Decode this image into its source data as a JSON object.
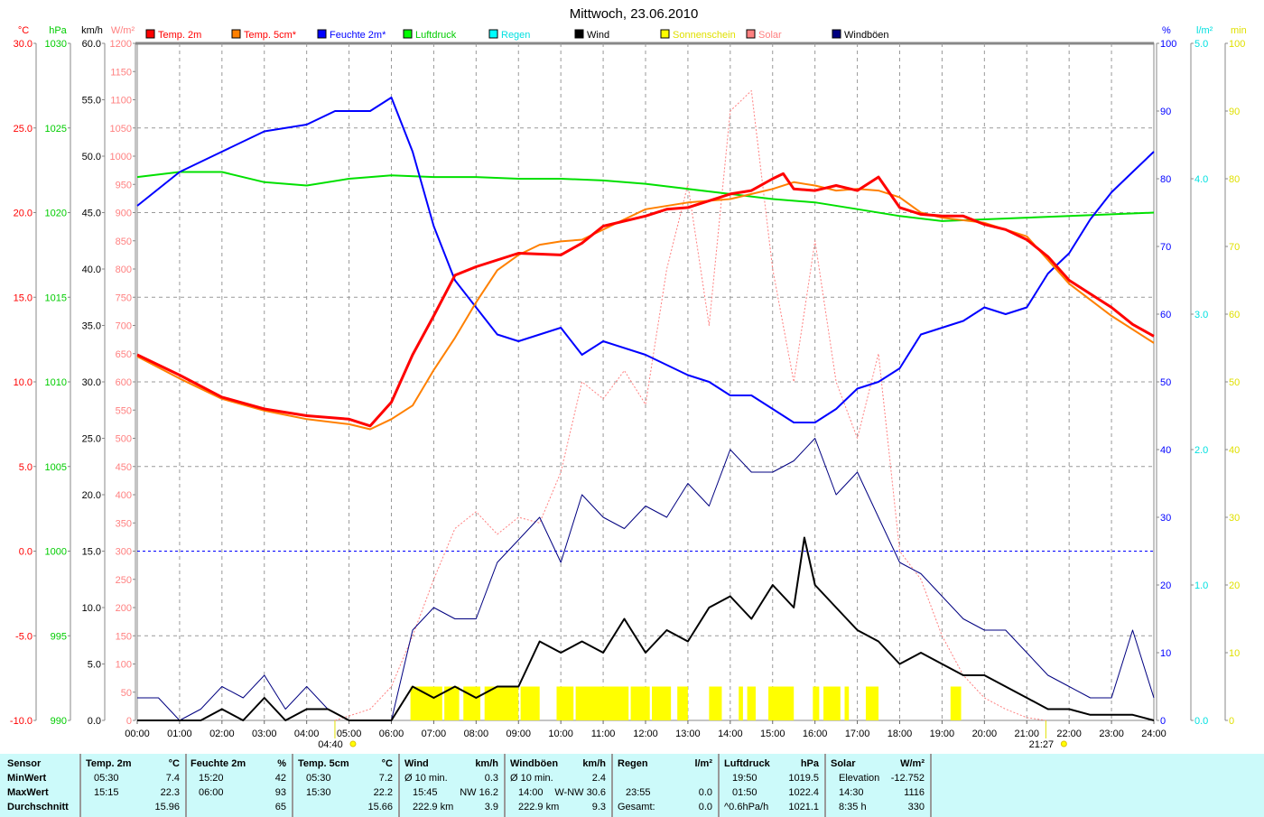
{
  "chart_data": {
    "type": "line",
    "title": "Mittwoch, 23.06.2010",
    "x_range_hours": [
      0,
      24
    ],
    "x_ticks": [
      "00:00",
      "01:00",
      "02:00",
      "03:00",
      "04:00",
      "05:00",
      "06:00",
      "07:00",
      "08:00",
      "09:00",
      "10:00",
      "11:00",
      "12:00",
      "13:00",
      "14:00",
      "15:00",
      "16:00",
      "17:00",
      "18:00",
      "19:00",
      "20:00",
      "21:00",
      "22:00",
      "23:00",
      "24:00"
    ],
    "sunrise": {
      "time": "04:40",
      "hour": 4.667
    },
    "sunset": {
      "time": "21:27",
      "hour": 21.45
    },
    "axes": {
      "temp": {
        "unit": "°C",
        "range": [
          -10,
          30
        ],
        "step": 5,
        "color": "#ff0000",
        "decimals": 1
      },
      "pressure": {
        "unit": "hPa",
        "range": [
          990,
          1030
        ],
        "step": 5,
        "color": "#00cc00",
        "decimals": 0
      },
      "wind": {
        "unit": "km/h",
        "range": [
          0,
          60
        ],
        "step": 5,
        "color": "#000000",
        "decimals": 1
      },
      "solar": {
        "unit": "W/m²",
        "range": [
          0,
          1200
        ],
        "step": 50,
        "color": "#ff8080",
        "decimals": 0
      },
      "humidity": {
        "unit": "%",
        "range": [
          0,
          100
        ],
        "step": 10,
        "color": "#0000ff",
        "decimals": 0
      },
      "rain": {
        "unit": "l/m²",
        "range": [
          0,
          5
        ],
        "step": 1,
        "color": "#00e0e0",
        "decimals": 1
      },
      "sunshine": {
        "unit": "min",
        "range": [
          0,
          100
        ],
        "step": 10,
        "color": "#e0e000",
        "decimals": 0
      }
    },
    "legend": [
      {
        "name": "Temp. 2m",
        "color": "#ff0000",
        "text_color": "#ff0000"
      },
      {
        "name": "Temp. 5cm*",
        "color": "#ff8000",
        "text_color": "#ff0000"
      },
      {
        "name": "Feuchte 2m*",
        "color": "#0000ff",
        "text_color": "#0000ff"
      },
      {
        "name": "Luftdruck",
        "color": "#00ff00",
        "text_color": "#00cc00"
      },
      {
        "name": "Regen",
        "color": "#00ffff",
        "text_color": "#00e0e0"
      },
      {
        "name": "Wind",
        "color": "#000000",
        "text_color": "#000000"
      },
      {
        "name": "Sonnenschein",
        "color": "#ffff00",
        "text_color": "#e0e000"
      },
      {
        "name": "Solar",
        "color": "#ff8080",
        "text_color": "#ff8080"
      },
      {
        "name": "Windböen",
        "color": "#000080",
        "text_color": "#000000"
      }
    ],
    "series": [
      {
        "name": "Solar",
        "axis": "solar",
        "color": "#ff8080",
        "style": "dotted",
        "x": [
          4.67,
          5.5,
          6,
          6.5,
          7,
          7.5,
          8,
          8.5,
          9,
          9.5,
          10,
          10.5,
          11,
          11.5,
          12,
          12.5,
          13,
          13.5,
          14,
          14.5,
          15,
          15.5,
          16,
          16.5,
          17,
          17.5,
          18,
          18.5,
          19,
          19.5,
          20,
          20.5,
          21,
          21.45
        ],
        "y": [
          0,
          20,
          60,
          150,
          250,
          340,
          370,
          330,
          360,
          350,
          440,
          600,
          570,
          620,
          560,
          800,
          950,
          700,
          1080,
          1116,
          800,
          600,
          850,
          600,
          500,
          650,
          300,
          250,
          150,
          80,
          40,
          20,
          5,
          0
        ]
      },
      {
        "name": "Windböen",
        "axis": "wind",
        "color": "#000080",
        "width": 1,
        "x": [
          0,
          0.5,
          1,
          1.5,
          2,
          2.5,
          3,
          3.5,
          4,
          4.5,
          5,
          5.5,
          6,
          6.5,
          7,
          7.5,
          8,
          8.5,
          9,
          9.5,
          10,
          10.5,
          11,
          11.5,
          12,
          12.5,
          13,
          13.5,
          14,
          14.5,
          15,
          15.5,
          16,
          16.5,
          17,
          17.5,
          18,
          18.5,
          19,
          19.5,
          20,
          20.5,
          21,
          21.5,
          22,
          22.5,
          23,
          23.5,
          24
        ],
        "y": [
          2,
          2,
          0,
          1,
          3,
          2,
          4,
          1,
          3,
          1,
          0,
          0,
          0,
          8,
          10,
          9,
          9,
          14,
          16,
          18,
          14,
          20,
          18,
          17,
          19,
          18,
          21,
          19,
          24,
          22,
          22,
          23,
          25,
          20,
          22,
          18,
          14,
          13,
          11,
          9,
          8,
          8,
          6,
          4,
          3,
          2,
          2,
          8,
          2
        ]
      },
      {
        "name": "Wind",
        "axis": "wind",
        "color": "#000000",
        "width": 2,
        "x": [
          0,
          0.5,
          1,
          1.5,
          2,
          2.5,
          3,
          3.5,
          4,
          4.5,
          5,
          5.5,
          6,
          6.5,
          7,
          7.5,
          8,
          8.5,
          9,
          9.5,
          10,
          10.5,
          11,
          11.5,
          12,
          12.5,
          13,
          13.5,
          14,
          14.5,
          15,
          15.5,
          15.75,
          16,
          16.5,
          17,
          17.5,
          18,
          18.5,
          19,
          19.5,
          20,
          20.5,
          21,
          21.5,
          22,
          22.5,
          23,
          23.5,
          24
        ],
        "y": [
          0,
          0,
          0,
          0,
          1,
          0,
          2,
          0,
          1,
          1,
          0,
          0,
          0,
          3,
          2,
          3,
          2,
          3,
          3,
          7,
          6,
          7,
          6,
          9,
          6,
          8,
          7,
          10,
          11,
          9,
          12,
          10,
          16.2,
          12,
          10,
          8,
          7,
          5,
          6,
          5,
          4,
          4,
          3,
          2,
          1,
          1,
          0.5,
          0.5,
          0.5,
          0
        ]
      },
      {
        "name": "Luftdruck",
        "axis": "pressure",
        "color": "#00e000",
        "width": 2,
        "x": [
          0,
          1,
          2,
          3,
          4,
          5,
          6,
          7,
          8,
          9,
          10,
          11,
          12,
          13,
          14,
          15,
          16,
          17,
          18,
          19,
          20,
          21,
          22,
          23,
          24
        ],
        "y": [
          1022.1,
          1022.4,
          1022.4,
          1021.8,
          1021.6,
          1022.0,
          1022.2,
          1022.1,
          1022.1,
          1022.0,
          1022.0,
          1021.9,
          1021.7,
          1021.4,
          1021.1,
          1020.8,
          1020.6,
          1020.2,
          1019.8,
          1019.5,
          1019.6,
          1019.7,
          1019.8,
          1019.9,
          1020.0
        ]
      },
      {
        "name": "Feuchte 2m*",
        "axis": "humidity",
        "color": "#0000ff",
        "width": 2,
        "x": [
          0,
          1,
          2,
          3,
          4,
          4.67,
          5,
          5.5,
          6,
          6.5,
          7,
          7.5,
          8,
          8.5,
          9,
          10,
          10.5,
          11,
          12,
          13,
          13.5,
          14,
          14.5,
          15,
          15.5,
          16,
          16.5,
          17,
          17.5,
          18,
          18.5,
          19,
          19.5,
          20,
          20.5,
          21,
          21.5,
          22,
          22.5,
          23,
          23.5,
          24
        ],
        "y": [
          76,
          81,
          84,
          87,
          88,
          90,
          90,
          90,
          92,
          84,
          73,
          65,
          61,
          57,
          56,
          58,
          54,
          56,
          54,
          51,
          50,
          48,
          48,
          46,
          44,
          44,
          46,
          49,
          50,
          52,
          57,
          58,
          59,
          61,
          60,
          61,
          66,
          69,
          74,
          78,
          81,
          84
        ]
      },
      {
        "name": "Temp. 5cm*",
        "axis": "temp",
        "color": "#ff8000",
        "width": 2,
        "x": [
          0,
          1,
          2,
          3,
          4,
          5,
          5.5,
          6,
          6.5,
          7,
          7.5,
          8,
          8.5,
          9,
          9.5,
          10,
          10.5,
          11,
          11.5,
          12,
          13,
          14,
          14.5,
          15,
          15.5,
          16,
          16.5,
          17,
          17.5,
          18,
          18.5,
          19,
          20,
          21,
          22,
          23,
          24
        ],
        "y": [
          11.5,
          10.2,
          9.0,
          8.3,
          7.8,
          7.5,
          7.2,
          7.8,
          8.6,
          10.7,
          12.6,
          14.7,
          16.6,
          17.5,
          18.1,
          18.3,
          18.4,
          19.0,
          19.6,
          20.2,
          20.6,
          20.8,
          21.1,
          21.4,
          21.8,
          21.6,
          21.3,
          21.4,
          21.3,
          20.9,
          20.0,
          19.7,
          19.4,
          18.6,
          15.8,
          13.9,
          12.3
        ]
      },
      {
        "name": "Temp. 2m",
        "axis": "temp",
        "color": "#ff0000",
        "width": 3,
        "x": [
          0,
          1,
          2,
          3,
          4,
          5,
          5.5,
          6,
          6.5,
          7,
          7.5,
          8,
          8.5,
          9,
          10,
          10.5,
          11,
          12,
          12.5,
          13,
          13.5,
          14,
          14.5,
          15,
          15.25,
          15.5,
          16,
          16.5,
          17,
          17.5,
          18,
          18.5,
          19,
          19.5,
          20,
          20.5,
          21,
          21.5,
          22,
          22.5,
          23,
          23.5,
          24
        ],
        "y": [
          11.6,
          10.4,
          9.1,
          8.4,
          8.0,
          7.8,
          7.4,
          8.8,
          11.6,
          13.9,
          16.3,
          16.8,
          17.2,
          17.6,
          17.5,
          18.2,
          19.2,
          19.8,
          20.2,
          20.3,
          20.7,
          21.1,
          21.3,
          22.0,
          22.3,
          21.4,
          21.3,
          21.6,
          21.3,
          22.1,
          20.3,
          19.9,
          19.8,
          19.8,
          19.3,
          19.0,
          18.4,
          17.4,
          16.0,
          15.2,
          14.4,
          13.4,
          12.7
        ]
      }
    ],
    "sunshine_intervals_hours": [
      [
        6.45,
        7.2
      ],
      [
        7.25,
        7.6
      ],
      [
        7.7,
        8.1
      ],
      [
        8.2,
        9.0
      ],
      [
        9.05,
        9.5
      ],
      [
        9.9,
        10.3
      ],
      [
        10.35,
        11.6
      ],
      [
        11.65,
        12.1
      ],
      [
        12.15,
        12.6
      ],
      [
        12.75,
        13.0
      ],
      [
        13.5,
        13.8
      ],
      [
        14.2,
        14.3
      ],
      [
        14.4,
        14.6
      ],
      [
        14.9,
        15.5
      ],
      [
        15.95,
        16.1
      ],
      [
        16.2,
        16.6
      ],
      [
        16.7,
        16.8
      ],
      [
        17.2,
        17.5
      ],
      [
        19.2,
        19.45
      ]
    ],
    "sunshine_bar_value_min": 5,
    "zero_line": {
      "axis": "temp",
      "value": 0,
      "color": "#0000ff"
    }
  },
  "stats": {
    "row_labels": [
      "Sensor",
      "MinWert",
      "MaxWert",
      "Durchschnitt"
    ],
    "columns": [
      {
        "name": "Temp. 2m",
        "unit": "°C",
        "rows": [
          [
            "05:30",
            "7.4"
          ],
          [
            "15:15",
            "22.3"
          ],
          [
            "",
            "15.96"
          ]
        ]
      },
      {
        "name": "Feuchte 2m",
        "unit": "%",
        "rows": [
          [
            "15:20",
            "42"
          ],
          [
            "06:00",
            "93"
          ],
          [
            "",
            "65"
          ]
        ]
      },
      {
        "name": "Temp. 5cm",
        "unit": "°C",
        "rows": [
          [
            "05:30",
            "7.2"
          ],
          [
            "15:30",
            "22.2"
          ],
          [
            "",
            "15.66"
          ]
        ]
      },
      {
        "name": "Wind",
        "unit": "km/h",
        "rows": [
          [
            "Ø 10 min.",
            "0.3"
          ],
          [
            "15:45",
            "NW 16.2"
          ],
          [
            "222.9 km",
            "3.9"
          ]
        ]
      },
      {
        "name": "Windböen",
        "unit": "km/h",
        "rows": [
          [
            "Ø 10 min.",
            "2.4"
          ],
          [
            "14:00",
            "W-NW 30.6"
          ],
          [
            "222.9 km",
            "9.3"
          ]
        ]
      },
      {
        "name": "Regen",
        "unit": "l/m²",
        "rows": [
          [
            "",
            ""
          ],
          [
            "23:55",
            "0.0"
          ],
          [
            "Gesamt:",
            "0.0"
          ]
        ]
      },
      {
        "name": "Luftdruck",
        "unit": "hPa",
        "rows": [
          [
            "19:50",
            "1019.5"
          ],
          [
            "01:50",
            "1022.4"
          ],
          [
            "^0.6hPa/h",
            "1021.1"
          ]
        ]
      },
      {
        "name": "Solar",
        "unit": "W/m²",
        "rows": [
          [
            "Elevation",
            "-12.752"
          ],
          [
            "14:30",
            "1116"
          ],
          [
            "8:35 h",
            "330"
          ]
        ]
      }
    ]
  }
}
